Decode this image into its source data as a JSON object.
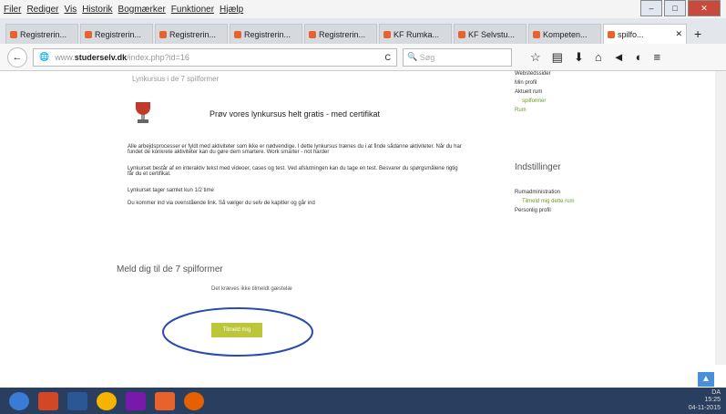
{
  "menu": [
    "Filer",
    "Rediger",
    "Vis",
    "Historik",
    "Bogmærker",
    "Funktioner",
    "Hjælp"
  ],
  "tabs": [
    {
      "label": "Registrerin..."
    },
    {
      "label": "Registrerin..."
    },
    {
      "label": "Registrerin..."
    },
    {
      "label": "Registrerin..."
    },
    {
      "label": "Registrerin..."
    },
    {
      "label": "KF Rumka..."
    },
    {
      "label": "KF Selvstu..."
    },
    {
      "label": "Kompeten..."
    },
    {
      "label": "spilfo..."
    }
  ],
  "address": {
    "host": "studerselv.dk",
    "path": "/index.php?id=16",
    "prefix": "www."
  },
  "search_placeholder": "Søg",
  "page": {
    "section_heading": "Lynkursus i de 7 spilformer",
    "promo": "Prøv vores lynkursus helt gratis - med certifikat",
    "paragraphs": [
      "Alle arbejdsprocesser er fyldt med aktiviteter som ikke er nødvendige. I dette lynkursus trænes du i at finde sådanne aktiviteter. Når du har fundet de konkrete aktiviteter kan du gøre dem smartere. Work smarter - not harder",
      "Lynkurset består af en interaktiv tekst med videoer, cases og test. Ved afslutningen kan du tage en test. Besvarer du spørgsmålene rigtig får du et certifikat.",
      "Lynkurset tager samlet kun 1/2 time",
      "Du kommer ind via ovenstående link. Så vælger du selv de kapitler og går ind"
    ],
    "signup_title": "Meld dig til de 7 spilformer",
    "signup_note": "Det kræves ikke tilmeldt gæstelæ",
    "signup_button": "Tilmeld mig"
  },
  "sidebar": {
    "items": [
      "Webstedssider",
      "Min profil",
      "Aktuelt rum",
      "spilformer",
      "Rum"
    ],
    "settings_title": "Indstillinger",
    "settings_items": [
      "Rumadministration",
      "Tilmeld mig dette rum",
      "Personlig profil"
    ]
  },
  "tray": {
    "time": "15:25",
    "date": "04-11-2015",
    "lang": "DA"
  }
}
